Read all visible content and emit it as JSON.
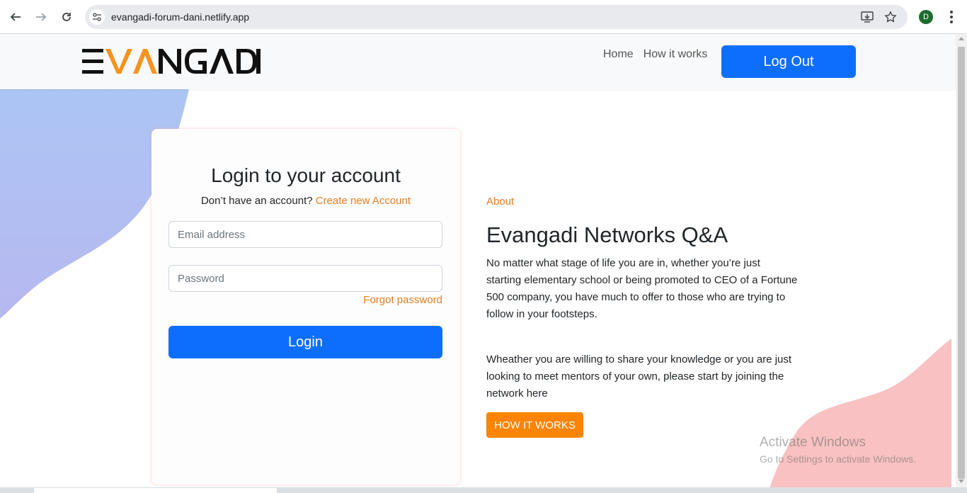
{
  "browser": {
    "url": "evangadi-forum-dani.netlify.app",
    "profile_initial": "D"
  },
  "header": {
    "logo_text": "EVANGADI",
    "nav": [
      "Home",
      "How it works"
    ],
    "logout_label": "Log Out"
  },
  "login": {
    "title": "Login to your account",
    "signup_prompt": "Don’t have an account?",
    "signup_link": "Create new Account",
    "email_placeholder": "Email address",
    "password_placeholder": "Password",
    "forgot_link": "Forgot password",
    "login_label": "Login"
  },
  "about": {
    "label": "About",
    "title": "Evangadi Networks Q&A",
    "paragraph1": "No matter what stage of life you are in, whether you’re just starting elementary school or being promoted to CEO of a Fortune 500 company, you have much to offer to those who are trying to follow in your footsteps.",
    "paragraph2": "Wheather you are willing to share your knowledge or you are just looking to meet mentors of your own, please start by joining the network here",
    "cta_label": "HOW IT WORKS"
  },
  "watermark": {
    "line1": "Activate Windows",
    "line2": "Go to Settings to activate Windows."
  },
  "colors": {
    "primary": "#0d6efd",
    "accent": "#e67e22",
    "cta": "#fe8402",
    "logo_orange": "#f7931e"
  }
}
